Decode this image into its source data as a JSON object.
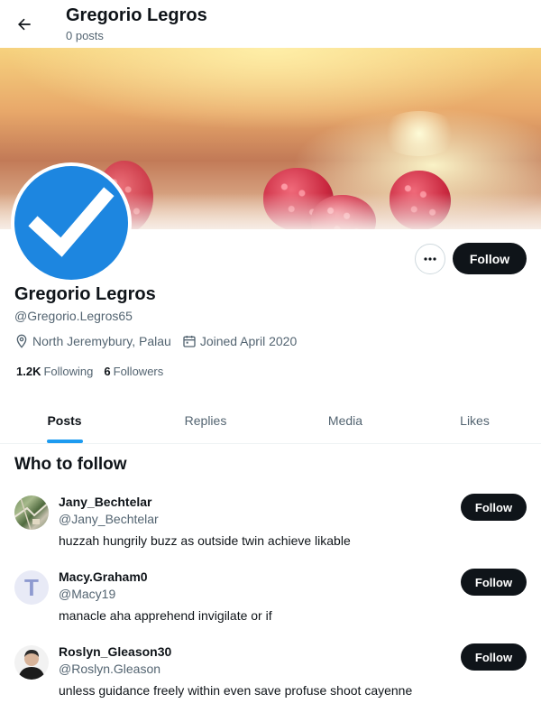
{
  "header": {
    "back_icon": "arrow-left-icon",
    "title": "Gregorio Legros",
    "subtitle": "0 posts"
  },
  "profile": {
    "avatar_icon": "verified-check-icon",
    "more_icon": "ellipsis-icon",
    "more_label": "···",
    "follow_label": "Follow",
    "name": "Gregorio Legros",
    "handle": "@Gregorio.Legros65",
    "location_icon": "location-pin-icon",
    "location": "North Jeremybury, Palau",
    "joined_icon": "calendar-icon",
    "joined": "Joined April 2020",
    "following_count": "1.2K",
    "following_label": "Following",
    "followers_count": "6",
    "followers_label": "Followers"
  },
  "tabs": [
    {
      "label": "Posts",
      "active": true
    },
    {
      "label": "Replies",
      "active": false
    },
    {
      "label": "Media",
      "active": false
    },
    {
      "label": "Likes",
      "active": false
    }
  ],
  "who_to_follow": {
    "heading": "Who to follow",
    "items": [
      {
        "name": "Jany_Bechtelar",
        "handle": "@Jany_Bechtelar",
        "bio": "huzzah hungrily buzz as outside twin achieve likable",
        "follow_label": "Follow",
        "avatar": "map-photo"
      },
      {
        "name": "Macy.Graham0",
        "handle": "@Macy19",
        "bio": "manacle aha apprehend invigilate or if",
        "follow_label": "Follow",
        "avatar": "letter-T",
        "avatar_letter": "T"
      },
      {
        "name": "Roslyn_Gleason30",
        "handle": "@Roslyn.Gleason",
        "bio": "unless guidance freely within even save profuse shoot cayenne",
        "follow_label": "Follow",
        "avatar": "person-photo"
      }
    ]
  },
  "colors": {
    "accent": "#1d9bf0",
    "button_dark": "#0f1419",
    "muted_text": "#536471",
    "verified_blue": "#1d86e0"
  }
}
